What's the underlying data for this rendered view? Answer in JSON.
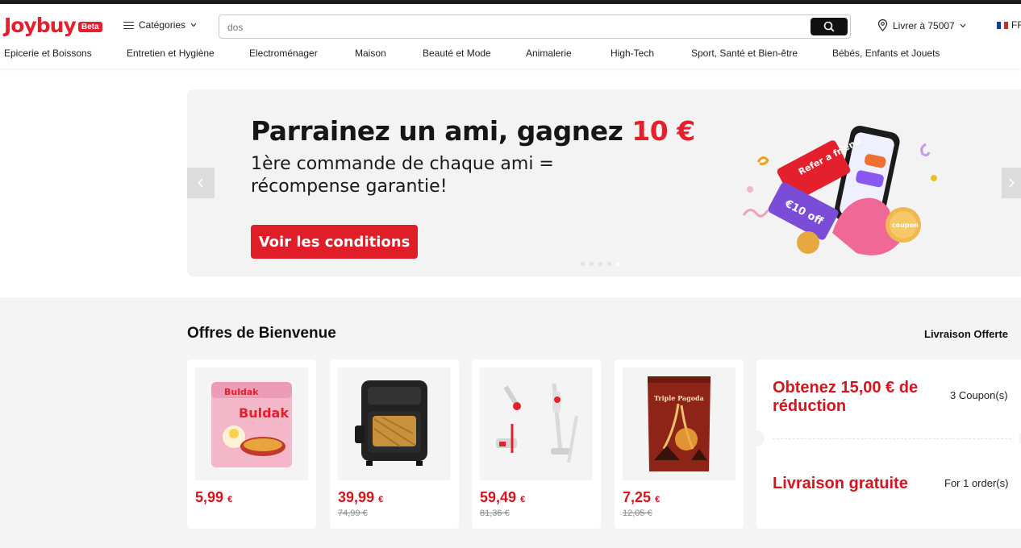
{
  "header": {
    "logo": "Joybuy",
    "badge": "Beta",
    "categories_label": "Catégories",
    "search": {
      "value": "",
      "placeholder": "dos"
    },
    "deliver_label": "Livrer à 75007",
    "language": "FR"
  },
  "nav": {
    "items": [
      "Epicerie et Boissons",
      "Entretien et Hygiène",
      "Electroménager",
      "Maison",
      "Beauté et Mode",
      "Animalerie",
      "High-Tech",
      "Sport, Santé et Bien-être",
      "Bébés, Enfants et Jouets"
    ]
  },
  "banner": {
    "title": "Parrainez un ami, gagnez ",
    "title_highlight": "10 €",
    "subtitle": "1ère commande de chaque ami = récompense garantie!",
    "cta": "Voir les conditions",
    "ticket_text_1": "Refer a friend",
    "ticket_text_2": "€10 off",
    "coin_text": "coupon",
    "active_slide": 5,
    "slide_count": 5
  },
  "offers": {
    "title": "Offres de Bienvenue",
    "link": "Livraison Offerte",
    "products": [
      {
        "name": "Buldak",
        "price": "5,99",
        "currency": "€",
        "old_price": ""
      },
      {
        "name": "air-fryer",
        "price": "39,99",
        "currency": "€",
        "old_price": "74,99 €"
      },
      {
        "name": "stick-vacuum",
        "price": "59,49",
        "currency": "€",
        "old_price": "81,36 €"
      },
      {
        "name": "Triple Pagoda",
        "price": "7,25",
        "currency": "€",
        "old_price": "12,05 €"
      }
    ],
    "coupon": {
      "title": "Obtenez 15,00 € de réduction",
      "count": "3 Coupon(s)",
      "shipping_title": "Livraison gratuite",
      "shipping_count": "For 1 order(s)"
    }
  },
  "colors": {
    "brand": "#e4202d",
    "price": "#d4141f",
    "cta": "#e01e28"
  }
}
